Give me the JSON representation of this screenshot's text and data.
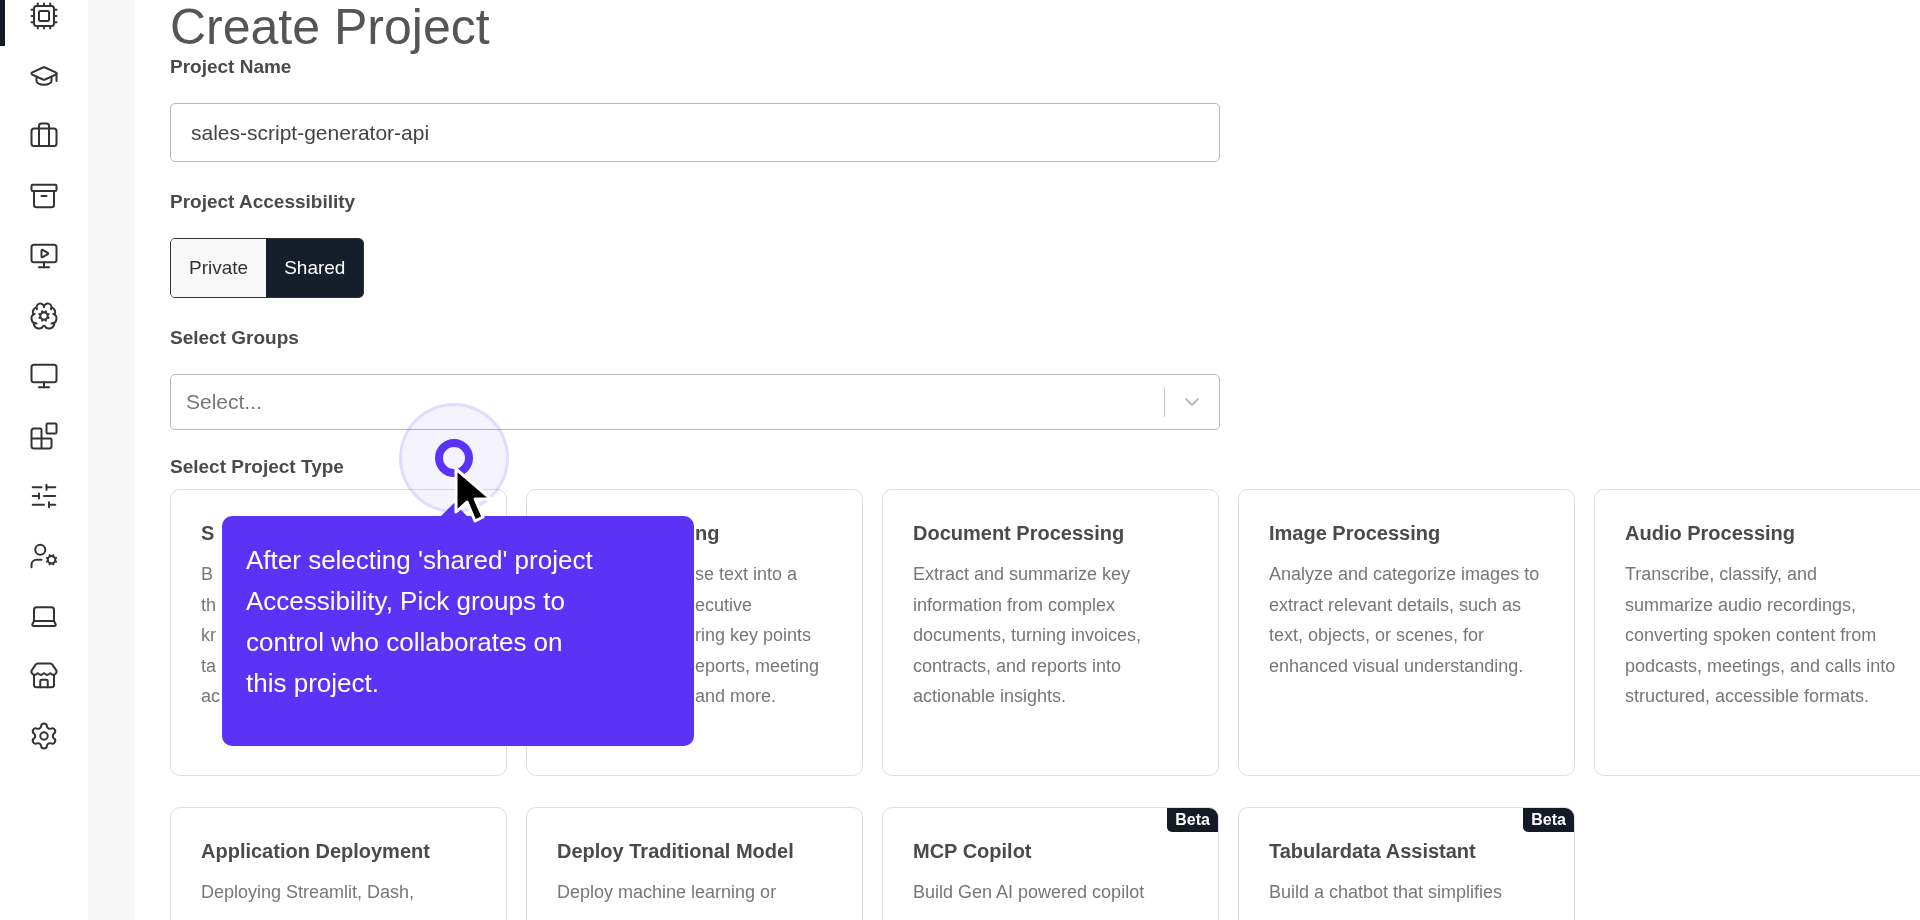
{
  "sidebar": {
    "items": [
      {
        "selected": true
      },
      {
        "selected": false
      },
      {
        "selected": false
      },
      {
        "selected": false
      },
      {
        "selected": false
      },
      {
        "selected": false
      },
      {
        "selected": false
      },
      {
        "selected": false
      },
      {
        "selected": false
      },
      {
        "selected": false
      },
      {
        "selected": false
      },
      {
        "selected": false
      },
      {
        "selected": false
      }
    ]
  },
  "title": "Create Project",
  "project_name": {
    "label": "Project Name",
    "value": "sales-script-generator-api"
  },
  "accessibility": {
    "label": "Project Accessibility",
    "options": [
      {
        "label": "Private",
        "selected": false
      },
      {
        "label": "Shared",
        "selected": true
      }
    ]
  },
  "groups": {
    "label": "Select Groups",
    "placeholder": "Select..."
  },
  "project_type": {
    "label": "Select Project Type",
    "cards": [
      {
        "kind": "plain",
        "title": "S",
        "description_lines": [
          "B",
          "th",
          "kr",
          "ta",
          "ac"
        ]
      },
      {
        "kind": "tail",
        "title": "ng",
        "description_lines": [
          "se text into a",
          "ecutive",
          "ring key points",
          "eports, meeting",
          "and more."
        ]
      },
      {
        "kind": "plain",
        "title": "Document Processing",
        "description_lines": [
          "Extract and summarize key information from complex documents, turning invoices, contracts, and reports into actionable insights."
        ]
      },
      {
        "kind": "plain",
        "title": "Image Processing",
        "description_lines": [
          "Analyze and categorize images to extract relevant details, such as text, objects, or scenes, for enhanced visual understanding."
        ]
      },
      {
        "kind": "plain",
        "title": "Audio Processing",
        "description_lines": [
          "Transcribe, classify, and summarize audio recordings, converting spoken content from podcasts, meetings, and calls into structured, accessible formats."
        ]
      },
      {
        "kind": "plain",
        "title": "Application Deployment",
        "description_lines": [
          "Deploying Streamlit, Dash,"
        ]
      },
      {
        "kind": "plain",
        "title": "Deploy Traditional Model",
        "description_lines": [
          "Deploy machine learning or"
        ]
      },
      {
        "kind": "plain",
        "title": "MCP Copilot",
        "description_lines": [
          "Build Gen AI powered copilot"
        ],
        "badge": "Beta"
      },
      {
        "kind": "plain",
        "title": "Tabulardata Assistant",
        "description_lines": [
          "Build a chatbot that simplifies"
        ],
        "badge": "Beta"
      }
    ]
  },
  "tooltip": {
    "text": "After selecting 'shared' project Accessibility, Pick groups to control who collaborates on this project."
  }
}
